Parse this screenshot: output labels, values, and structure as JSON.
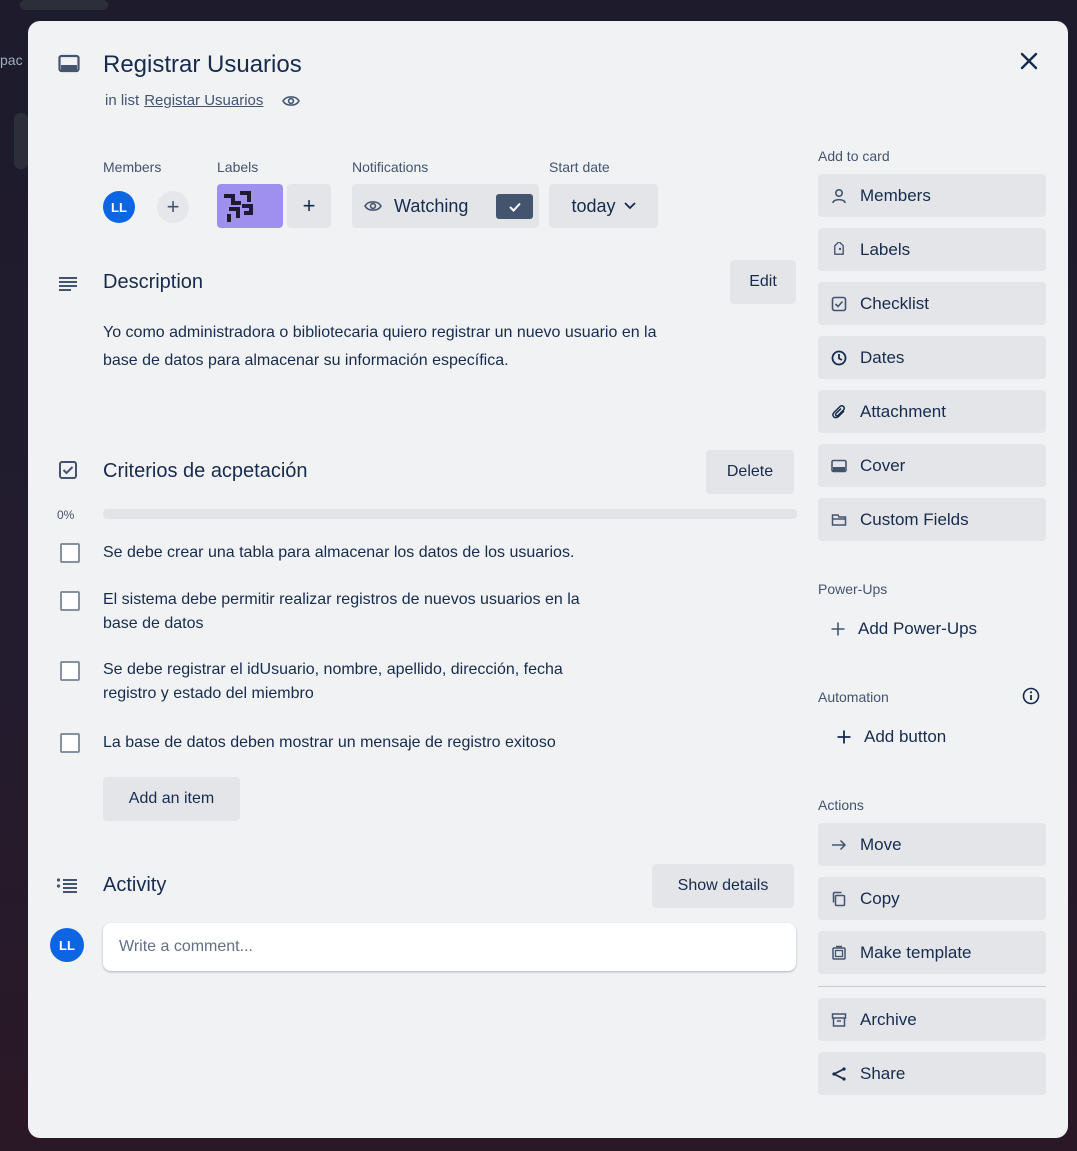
{
  "background": {
    "fragment_text": "pac"
  },
  "card": {
    "title": "Registrar Usuarios",
    "list_prefix": "in list",
    "list_name": "Registar Usuarios",
    "close_icon": "close-icon"
  },
  "meta": {
    "members_label": "Members",
    "labels_label": "Labels",
    "notifications_label": "Notifications",
    "start_date_label": "Start date",
    "member_initials": "LL",
    "add_symbol": "+",
    "watching": "Watching",
    "start_date_value": "today"
  },
  "description": {
    "title": "Description",
    "edit": "Edit",
    "line1": "Yo como administradora o bibliotecaria quiero registrar un nuevo usuario en la",
    "line2": "base de datos para almacenar su información específica."
  },
  "checklist": {
    "title": "Criterios de acpetación",
    "delete": "Delete",
    "progress_text": "0%",
    "progress_value": 0,
    "items": [
      {
        "line1": "Se debe crear una tabla para almacenar los datos de los usuarios.",
        "line2": "",
        "checked": false
      },
      {
        "line1": "El sistema debe permitir realizar registros de nuevos usuarios en la",
        "line2": "base de datos",
        "checked": false
      },
      {
        "line1": "Se debe registrar el idUsuario, nombre, apellido, dirección, fecha",
        "line2": "registro y estado del miembro",
        "checked": false
      },
      {
        "line1": "La base de datos deben mostrar un mensaje de registro exitoso",
        "line2": "",
        "checked": false
      }
    ],
    "add_item": "Add an item"
  },
  "activity": {
    "title": "Activity",
    "show_details": "Show details",
    "avatar": "LL",
    "comment_placeholder": "Write a comment..."
  },
  "sidebar": {
    "add_to_card": "Add to card",
    "members": "Members",
    "labels": "Labels",
    "checklist": "Checklist",
    "dates": "Dates",
    "attachment": "Attachment",
    "cover": "Cover",
    "custom_fields": "Custom Fields",
    "power_ups_head": "Power-Ups",
    "add_power_ups": "Add Power-Ups",
    "automation_head": "Automation",
    "add_button": "Add button",
    "actions_head": "Actions",
    "move": "Move",
    "copy": "Copy",
    "make_template": "Make template",
    "archive": "Archive",
    "share": "Share"
  },
  "colors": {
    "accent_blue": "#0c66e4",
    "label_purple": "#9f8fef",
    "modal_bg": "#f1f2f4",
    "button_bg": "#e3e5e8",
    "watch_check_bg": "#44546f"
  }
}
